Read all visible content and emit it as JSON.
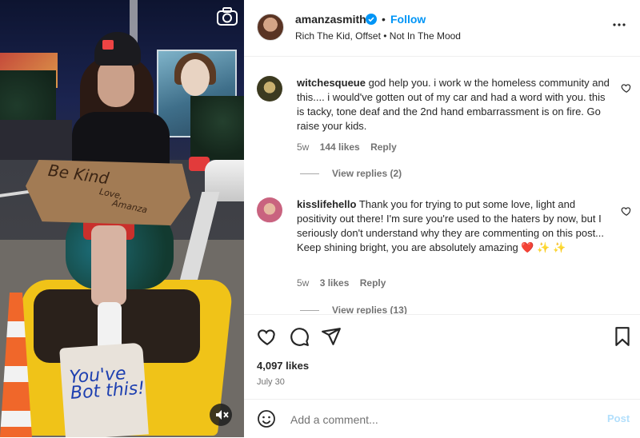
{
  "post": {
    "username": "amanzasmith",
    "separator": "•",
    "follow_label": "Follow",
    "audio": "Rich The Kid, Offset • Not In The Mood",
    "verified": true
  },
  "media": {
    "sign_text": "Be Kind",
    "sign_sub": "Love,",
    "sign_sub2": "Amanza",
    "bag_text": "You've Bot this!",
    "icons": {
      "camera": "camera-icon",
      "mute": "speaker-muted-icon"
    }
  },
  "comments": [
    {
      "username": "witchesqueue",
      "text": "god help you. i work w the homeless community and this.... i would've gotten out of my car and had a word with you. this is tacky, tone deaf and the 2nd hand embarrassment is on fire. Go raise your kids.",
      "age": "5w",
      "likes": "144 likes",
      "reply_label": "Reply",
      "view_replies": "View replies (2)"
    },
    {
      "username": "kisslifehello",
      "text": "Thank you for trying to put some love, light and positivity out there! I'm sure you're used to the haters by now, but I seriously don't understand why they are commenting on this post... Keep shining bright, you are absolutely amazing ❤️ ✨ ✨",
      "age": "5w",
      "likes": "3 likes",
      "reply_label": "Reply",
      "view_replies": "View replies (13)"
    }
  ],
  "actions": {
    "likes": "4,097 likes",
    "date": "July 30",
    "icons": [
      "heart-icon",
      "comment-icon",
      "share-icon",
      "bookmark-icon"
    ]
  },
  "composer": {
    "placeholder": "Add a comment...",
    "post_label": "Post"
  },
  "colors": {
    "accent": "#0095f6",
    "post_disabled": "#b2dffc",
    "text": "#262626",
    "muted": "#737373"
  }
}
